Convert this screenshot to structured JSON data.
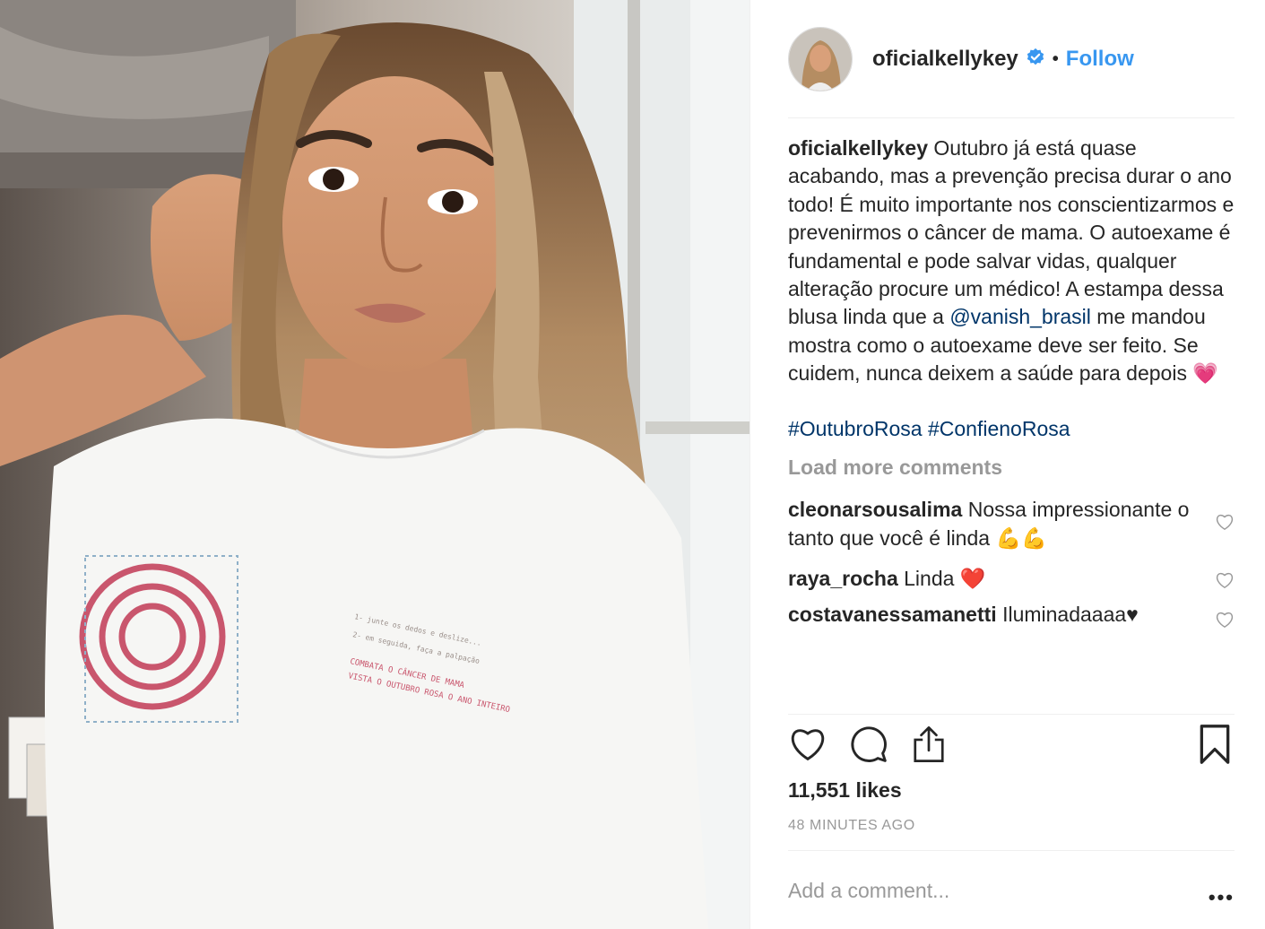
{
  "post": {
    "username": "oficialkellykey",
    "follow_label": "Follow",
    "dot": "•",
    "caption": {
      "username": "oficialkellykey",
      "text_before_mention": "Outubro já está quase acabando, mas a prevenção precisa durar o ano todo! É muito importante nos conscientizarmos e prevenirmos o câncer de mama. O autoexame é fundamental e pode salvar vidas, qualquer alteração procure um médico! A estampa dessa blusa linda que a ",
      "mention": "@vanish_brasil",
      "text_after_mention": " me mandou mostra como o autoexame deve ser feito. Se cuidem, nunca deixem a saúde para depois",
      "emoji": "💗",
      "hashtag1": "#OutubroRosa",
      "hashtag2": "#ConfienoRosa"
    },
    "load_more": "Load more comments",
    "comments": [
      {
        "username": "cleonarsousalima",
        "text": "Nossa impressionante o tanto que você é linda",
        "emoji": "💪💪"
      },
      {
        "username": "raya_rocha",
        "text": "Linda",
        "emoji": "❤️"
      },
      {
        "username": "costavanessamanetti",
        "text": "Iluminadaaaa♥"
      }
    ],
    "likes": "11,551 likes",
    "time": "48 MINUTES AGO",
    "add_comment_placeholder": "Add a comment...",
    "more_label": "•••"
  },
  "colors": {
    "link": "#3897f0",
    "mention": "#003569",
    "muted": "#999999",
    "text": "#262626",
    "divider": "#efefef",
    "verified": "#3897f0"
  },
  "icons": [
    "verified-badge-icon",
    "heart-icon",
    "comment-icon",
    "share-icon",
    "bookmark-icon",
    "more-options-icon",
    "comment-like-heart-icon"
  ]
}
